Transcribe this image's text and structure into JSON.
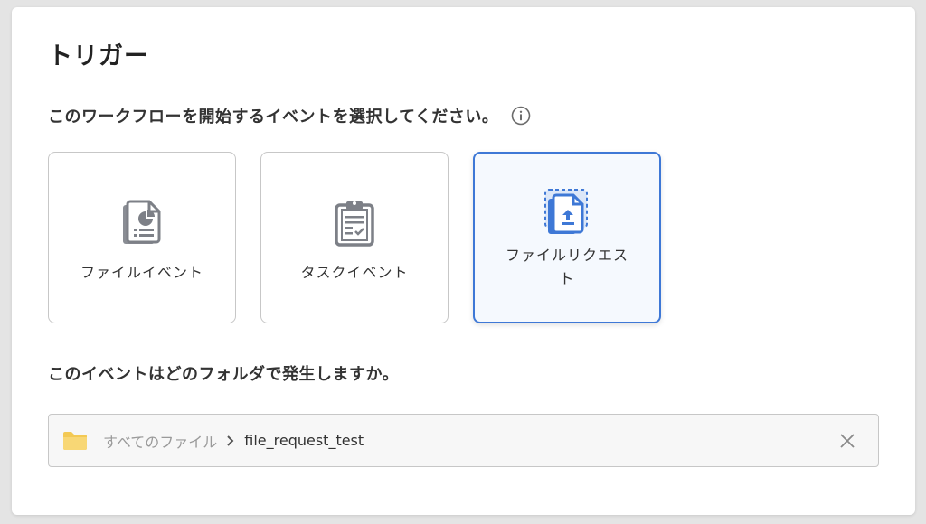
{
  "trigger": {
    "title": "トリガー",
    "prompt": "このワークフローを開始するイベントを選択してください。",
    "info_icon": "info-icon",
    "options": [
      {
        "label": "ファイルイベント",
        "icon": "file-chart-icon",
        "selected": false
      },
      {
        "label": "タスクイベント",
        "icon": "clipboard-check-icon",
        "selected": false
      },
      {
        "label": "ファイルリクエスト",
        "icon": "file-upload-icon",
        "selected": true
      }
    ]
  },
  "folder": {
    "question": "このイベントはどのフォルダで発生しますか。",
    "root_label": "すべてのファイル",
    "current_label": "file_request_test",
    "folder_icon": "folder-icon",
    "separator_icon": "chevron-right-icon",
    "clear_icon": "close-icon"
  },
  "colors": {
    "accent": "#3e78d6",
    "selected_bg": "#f5f9fe",
    "icon_gray": "#7d8087",
    "folder_yellow": "#f8d775"
  }
}
